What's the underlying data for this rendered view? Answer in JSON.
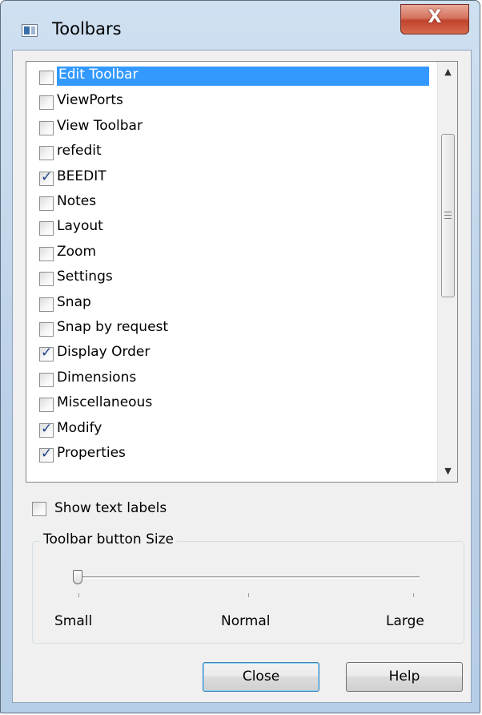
{
  "window": {
    "title": "Toolbars",
    "close_glyph": "X"
  },
  "toolbar_list": {
    "items": [
      {
        "label": "Edit Toolbar",
        "checked": false,
        "selected": true
      },
      {
        "label": "ViewPorts",
        "checked": false
      },
      {
        "label": "View Toolbar",
        "checked": false
      },
      {
        "label": "refedit",
        "checked": false
      },
      {
        "label": "BEEDIT",
        "checked": true
      },
      {
        "label": "Notes",
        "checked": false
      },
      {
        "label": "Layout",
        "checked": false
      },
      {
        "label": "Zoom",
        "checked": false
      },
      {
        "label": "Settings",
        "checked": false
      },
      {
        "label": "Snap",
        "checked": false
      },
      {
        "label": "Snap by request",
        "checked": false
      },
      {
        "label": "Display Order",
        "checked": true
      },
      {
        "label": "Dimensions",
        "checked": false
      },
      {
        "label": "Miscellaneous",
        "checked": false
      },
      {
        "label": "Modify",
        "checked": true
      },
      {
        "label": "Properties",
        "checked": true
      }
    ],
    "scroll_up_icon": "▲",
    "scroll_down_icon": "▼",
    "scroll_grip": "≡"
  },
  "show_text_labels": {
    "label": "Show text labels",
    "checked": false
  },
  "button_size": {
    "group_title": "Toolbar button Size",
    "ticks": [
      "Small",
      "Normal",
      "Large"
    ],
    "selected": "Small"
  },
  "buttons": {
    "close": "Close",
    "help": "Help"
  },
  "colors": {
    "selection": "#3399ff",
    "close_button": "#c1432c"
  }
}
